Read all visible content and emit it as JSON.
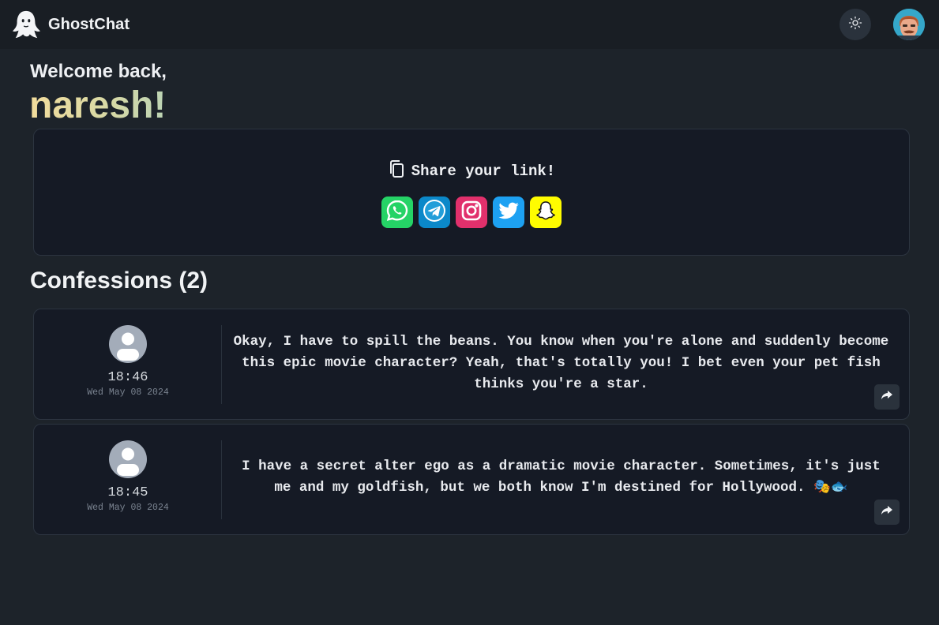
{
  "app": {
    "name": "GhostChat",
    "logo_icon": "ghost-icon",
    "theme_toggle_icon": "sun-icon",
    "user_avatar_icon": "user-photo-avatar"
  },
  "welcome": {
    "greeting": "Welcome back,",
    "username": "naresh!"
  },
  "share": {
    "title": "Share your link!",
    "copy_icon": "copy-icon",
    "platforms": [
      {
        "name": "whatsapp",
        "icon": "whatsapp-icon",
        "color": "#25d366"
      },
      {
        "name": "telegram",
        "icon": "telegram-icon",
        "color": "#229ed9"
      },
      {
        "name": "instagram",
        "icon": "instagram-icon",
        "color": "#e1306c"
      },
      {
        "name": "twitter",
        "icon": "twitter-icon",
        "color": "#1da1f2"
      },
      {
        "name": "snapchat",
        "icon": "snapchat-icon",
        "color": "#fffc00"
      }
    ]
  },
  "confessions": {
    "title": "Confessions (2)",
    "items": [
      {
        "time": "18:46",
        "date": "Wed May 08 2024",
        "text": "Okay, I have to spill the beans. You know when you're alone and suddenly become this epic movie character? Yeah, that's totally you! I bet even your pet fish thinks you're a star."
      },
      {
        "time": "18:45",
        "date": "Wed May 08 2024",
        "text": "I have a secret alter ego as a dramatic movie character. Sometimes, it's just me and my goldfish, but we both know I'm destined for Hollywood. 🎭🐟"
      }
    ]
  }
}
